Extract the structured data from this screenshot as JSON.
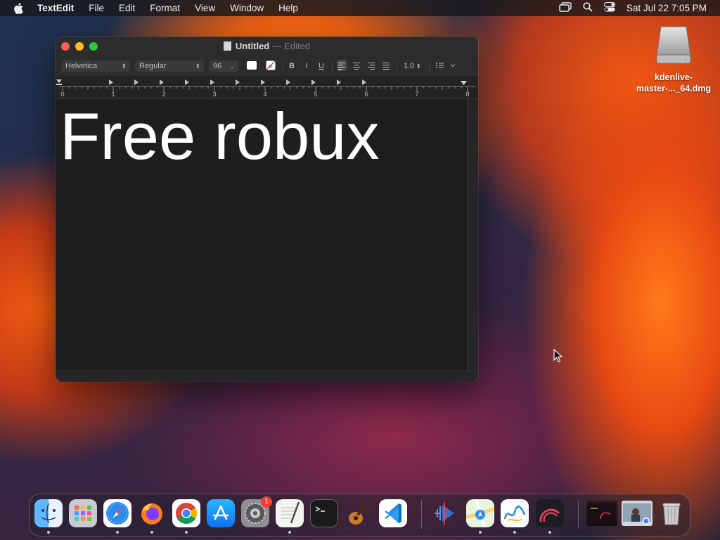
{
  "menubar": {
    "app_name": "TextEdit",
    "menus": [
      "File",
      "Edit",
      "Format",
      "View",
      "Window",
      "Help"
    ],
    "clock": "Sat Jul 22  7:05 PM"
  },
  "window": {
    "title": "Untitled",
    "title_separator": "—",
    "status": "Edited",
    "toolbar": {
      "font_family": "Helvetica",
      "font_style": "Regular",
      "font_size": "96",
      "bold": "B",
      "italic": "I",
      "underline": "U",
      "line_spacing": "1.0"
    },
    "ruler_labels": [
      "0",
      "1",
      "2",
      "3",
      "4",
      "5",
      "6",
      "7",
      "8"
    ],
    "document_text": "Free robux"
  },
  "desktop": {
    "disk_label": "kdenlive-master-..._64.dmg",
    "disk_label_line1": "kdenlive-",
    "disk_label_line2": "master-..._64.dmg"
  },
  "dock": {
    "items": [
      {
        "name": "finder-icon",
        "running": true
      },
      {
        "name": "launchpad-icon",
        "running": false
      },
      {
        "name": "safari-icon",
        "running": true
      },
      {
        "name": "firefox-icon",
        "running": true
      },
      {
        "name": "chrome-icon",
        "running": true
      },
      {
        "name": "app-store-icon",
        "running": false
      },
      {
        "name": "system-settings-icon",
        "running": false,
        "badge": "1"
      },
      {
        "name": "textedit-icon",
        "running": true
      },
      {
        "name": "terminal-icon",
        "running": false
      },
      {
        "name": "garageband-icon",
        "running": false
      },
      {
        "name": "vscode-icon",
        "running": false
      },
      {
        "name": "kdenlive-icon",
        "running": false
      },
      {
        "name": "maps-icon",
        "running": true
      },
      {
        "name": "freeform-icon",
        "running": true
      },
      {
        "name": "speedometer-app-icon",
        "running": true
      },
      {
        "name": "recent-window-thumbnail-1",
        "running": false
      },
      {
        "name": "recent-window-thumbnail-2",
        "running": false
      },
      {
        "name": "trash-icon",
        "running": false
      }
    ],
    "settings_badge": "1"
  }
}
